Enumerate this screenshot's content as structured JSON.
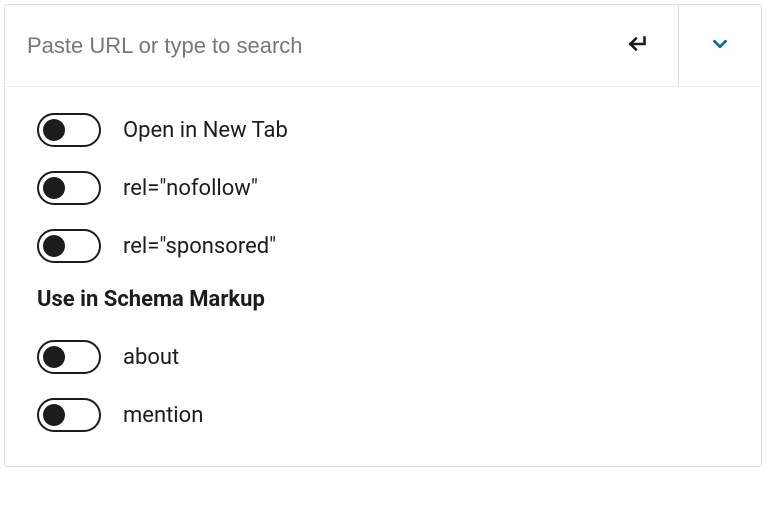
{
  "search": {
    "placeholder": "Paste URL or type to search",
    "value": ""
  },
  "icons": {
    "submit": "enter-icon",
    "expand": "chevron-down-icon"
  },
  "colors": {
    "accent": "#0073aa",
    "text": "#1c1c1c",
    "border": "#dddddd"
  },
  "options": {
    "items": [
      {
        "label": "Open in New Tab",
        "checked": false
      },
      {
        "label": "rel=\"nofollow\"",
        "checked": false
      },
      {
        "label": "rel=\"sponsored\"",
        "checked": false
      }
    ]
  },
  "schema": {
    "heading": "Use in Schema Markup",
    "items": [
      {
        "label": "about",
        "checked": false
      },
      {
        "label": "mention",
        "checked": false
      }
    ]
  }
}
